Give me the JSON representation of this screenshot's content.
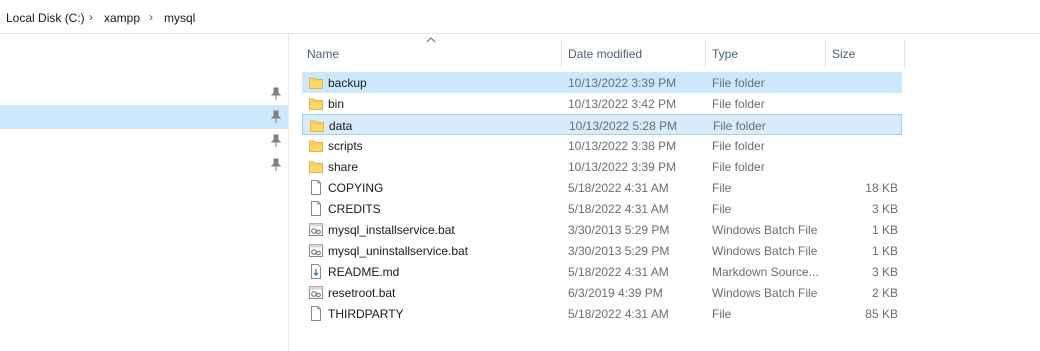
{
  "breadcrumb": {
    "items": [
      "Local Disk (C:)",
      "xampp",
      "mysql"
    ],
    "separator": "›"
  },
  "columns": {
    "name": "Name",
    "date_modified": "Date modified",
    "type": "Type",
    "size": "Size"
  },
  "files": [
    {
      "name": "backup",
      "date": "10/13/2022 3:39 PM",
      "type": "File folder",
      "size": "",
      "icon": "folder-icon"
    },
    {
      "name": "bin",
      "date": "10/13/2022 3:42 PM",
      "type": "File folder",
      "size": "",
      "icon": "folder-icon"
    },
    {
      "name": "data",
      "date": "10/13/2022 5:28 PM",
      "type": "File folder",
      "size": "",
      "icon": "folder-icon"
    },
    {
      "name": "scripts",
      "date": "10/13/2022 3:38 PM",
      "type": "File folder",
      "size": "",
      "icon": "folder-icon"
    },
    {
      "name": "share",
      "date": "10/13/2022 3:39 PM",
      "type": "File folder",
      "size": "",
      "icon": "folder-icon"
    },
    {
      "name": "COPYING",
      "date": "5/18/2022 4:31 AM",
      "type": "File",
      "size": "18 KB",
      "icon": "file-icon"
    },
    {
      "name": "CREDITS",
      "date": "5/18/2022 4:31 AM",
      "type": "File",
      "size": "3 KB",
      "icon": "file-icon"
    },
    {
      "name": "mysql_installservice.bat",
      "date": "3/30/2013 5:29 PM",
      "type": "Windows Batch File",
      "size": "1 KB",
      "icon": "batch-file-icon"
    },
    {
      "name": "mysql_uninstallservice.bat",
      "date": "3/30/2013 5:29 PM",
      "type": "Windows Batch File",
      "size": "1 KB",
      "icon": "batch-file-icon"
    },
    {
      "name": "README.md",
      "date": "5/18/2022 4:31 AM",
      "type": "Markdown Source...",
      "size": "3 KB",
      "icon": "markdown-file-icon"
    },
    {
      "name": "resetroot.bat",
      "date": "6/3/2019 4:39 PM",
      "type": "Windows Batch File",
      "size": "2 KB",
      "icon": "batch-file-icon"
    },
    {
      "name": "THIRDPARTY",
      "date": "5/18/2022 4:31 AM",
      "type": "File",
      "size": "85 KB",
      "icon": "file-icon"
    }
  ],
  "row_states": {
    "hovered_row": "backup",
    "selected_row": "data"
  },
  "colors": {
    "hover": "#cce8ff",
    "selected": "#d9ebf9",
    "selected_border": "#99d1ff",
    "folder": "#ffd769",
    "header_text": "#4c607a",
    "meta_text": "#6d6d6d"
  }
}
